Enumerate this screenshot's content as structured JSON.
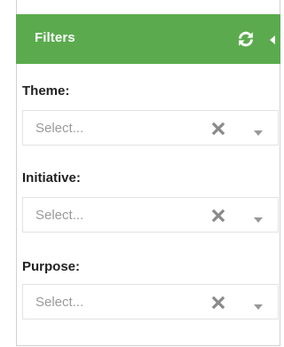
{
  "header": {
    "title": "Filters",
    "refresh_icon": "refresh-icon",
    "collapse_icon": "caret-left-icon",
    "background": "#5bab4e"
  },
  "filters": [
    {
      "label": "Theme:",
      "placeholder": "Select..."
    },
    {
      "label": "Initiative:",
      "placeholder": "Select..."
    },
    {
      "label": "Purpose:",
      "placeholder": "Select..."
    }
  ],
  "icons": {
    "clear": "clear-x-icon",
    "dropdown": "chevron-down-icon"
  }
}
